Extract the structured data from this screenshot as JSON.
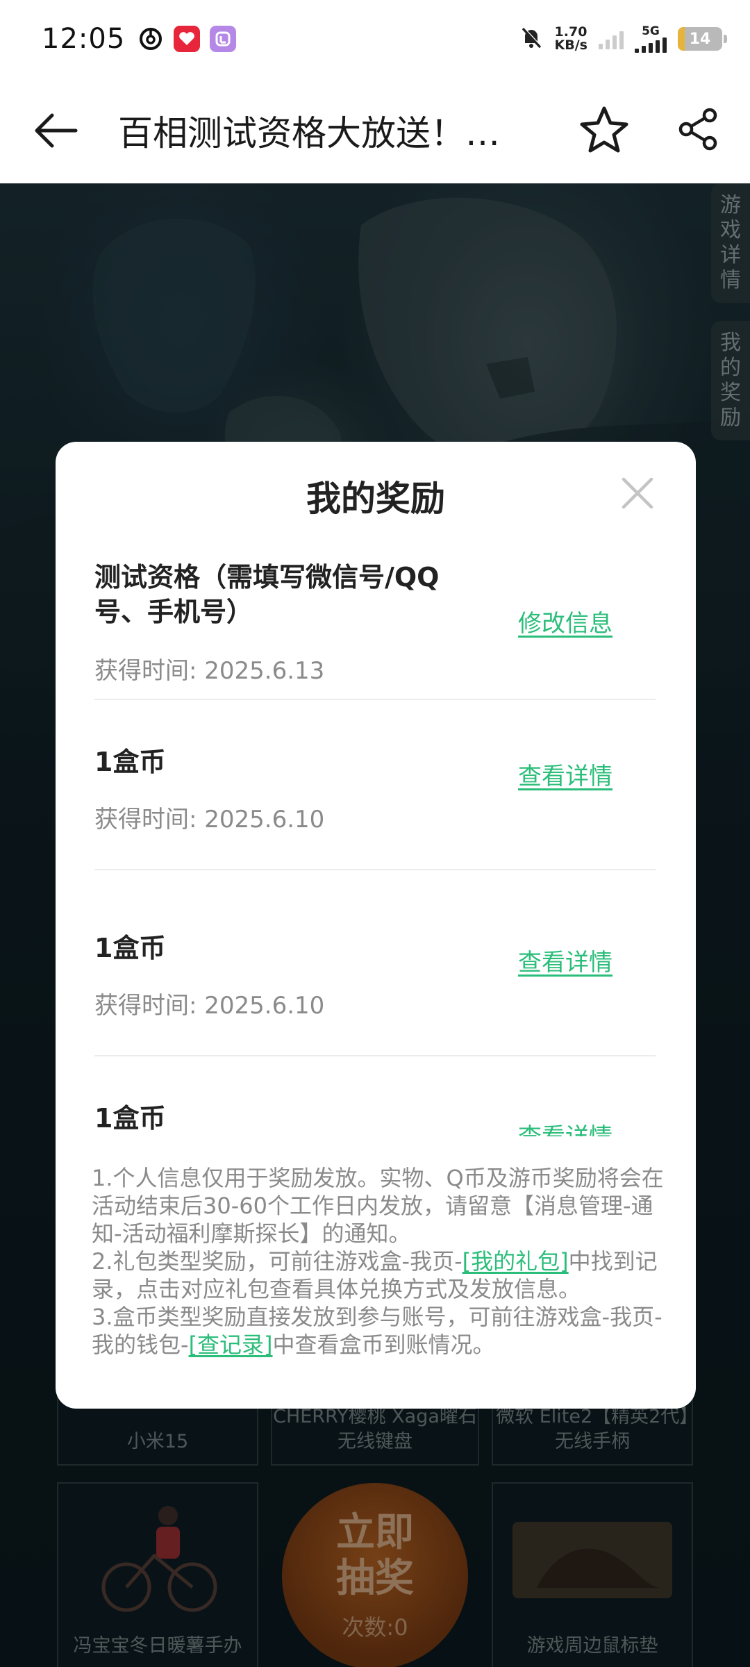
{
  "status_bar": {
    "time": "12:05",
    "net_speed_value": "1.70",
    "net_speed_unit": "KB/s",
    "network_type": "5G",
    "battery": "14"
  },
  "nav": {
    "title": "百相测试资格大放送！…"
  },
  "side_tabs": [
    {
      "label": "游戏详情"
    },
    {
      "label": "我的奖励"
    }
  ],
  "modal": {
    "title": "我的奖励",
    "rewards": [
      {
        "title": "测试资格（需填写微信号/QQ号、手机号）",
        "time": "获得时间: 2025.6.13",
        "action": "修改信息"
      },
      {
        "title": "1盒币",
        "time": "获得时间: 2025.6.10",
        "action": "查看详情"
      },
      {
        "title": "1盒币",
        "time": "获得时间: 2025.6.10",
        "action": "查看详情"
      },
      {
        "title": "1盒币",
        "time": "",
        "action": "查看详情"
      }
    ],
    "notes": {
      "line1": "1.个人信息仅用于奖励发放。实物、Q币及游币奖励将会在活动结束后30-60个工作日内发放，请留意【消息管理-通知-活动福利摩斯探长】的通知。",
      "line2_prefix": "2.礼包类型奖励，可前往游戏盒-我页-",
      "line2_link": "[我的礼包]",
      "line2_suffix": "中找到记录，点击对应礼包查看具体兑换方式及发放信息。",
      "line3_prefix": "3.盒币类型奖励直接发放到参与账号，可前往游戏盒-我页-我的钱包-",
      "line3_link": "[查记录]",
      "line3_suffix": "中查看盒币到账情况。"
    }
  },
  "prizes": {
    "top_row": [
      "小米15",
      "CHERRY樱桃 Xaga曜石 无线键盘",
      "微软 Elite2【精英2代】无线手柄"
    ],
    "bottom_left": "冯宝宝冬日暖薯手办",
    "draw_button": {
      "label": "立即抽奖",
      "count": "次数:0"
    },
    "bottom_right": "游戏周边鼠标垫"
  },
  "colors": {
    "accent_green": "#2bbd7a",
    "draw_button": "#8a4618"
  }
}
